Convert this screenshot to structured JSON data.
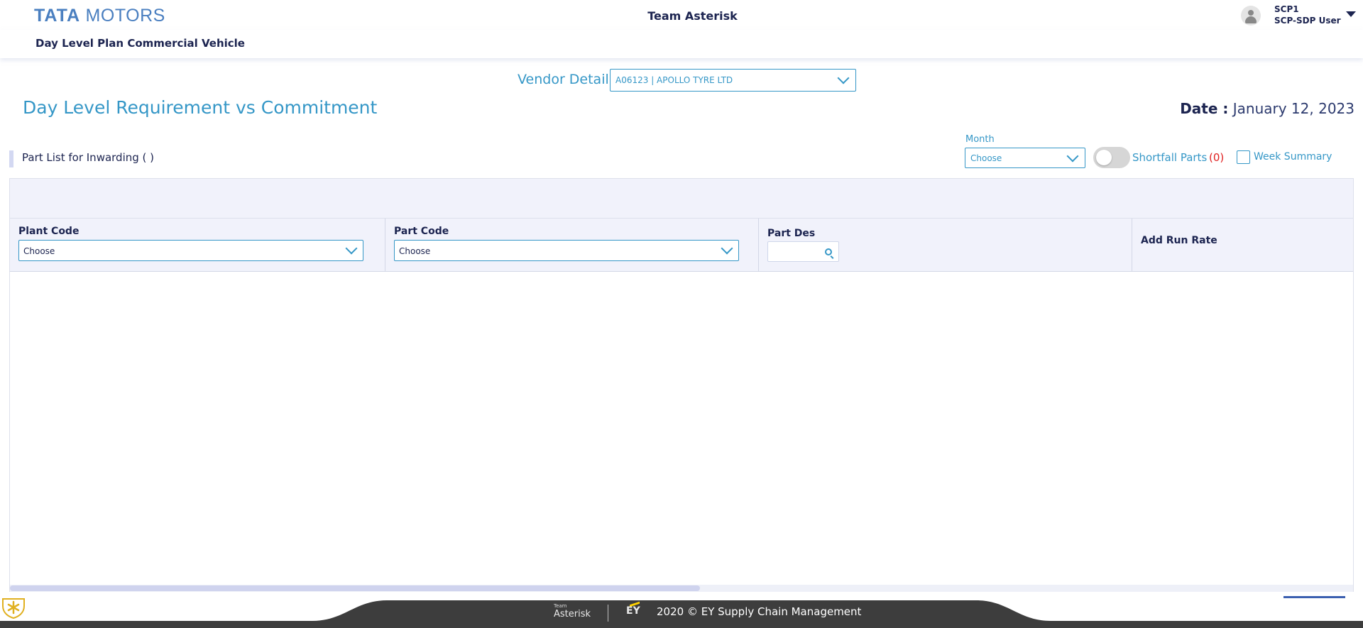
{
  "header": {
    "brand_bold": "TATA",
    "brand_rest": "MOTORS",
    "app_title": "Team Asterisk",
    "user": {
      "name": "SCP1",
      "role": "SCP-SDP User"
    }
  },
  "subheader": {
    "title": "Day Level Plan Commercial Vehicle"
  },
  "vendor": {
    "label": "Vendor Detail",
    "selected": "A06123 | APOLLO TYRE LTD"
  },
  "main": {
    "title": "Day Level Requirement vs Commitment",
    "date_label": "Date :",
    "date_value": "January 12, 2023"
  },
  "part_list": {
    "title": "Part List for Inwarding ( )",
    "month": {
      "label": "Month",
      "selected": "Choose"
    },
    "shortfall": {
      "label": "Shortfall Parts",
      "count": "(0)",
      "enabled": false
    },
    "week_summary": {
      "label": "Week Summary",
      "checked": false
    }
  },
  "table": {
    "columns": {
      "plant_code": {
        "label": "Plant Code",
        "selected": "Choose"
      },
      "part_code": {
        "label": "Part Code",
        "selected": "Choose"
      },
      "part_des": {
        "label": "Part Des",
        "value": ""
      },
      "add_run_rate": {
        "label": "Add Run Rate"
      }
    },
    "rows": []
  },
  "footer": {
    "team_small": "Team",
    "team": "Asterisk",
    "ey": "EY",
    "copyright": "2020 © EY Supply Chain Management"
  },
  "colors": {
    "accent_blue": "#3597c7",
    "navy_text": "#1c2450",
    "shortfall_red": "#e02020",
    "footer_dark": "#3d3d3d",
    "brand_blue": "#4a7fc0"
  },
  "icons": [
    "user-avatar-icon",
    "chevron-down-icon",
    "caret-down-icon",
    "search-icon",
    "asterisk-logo-icon"
  ]
}
